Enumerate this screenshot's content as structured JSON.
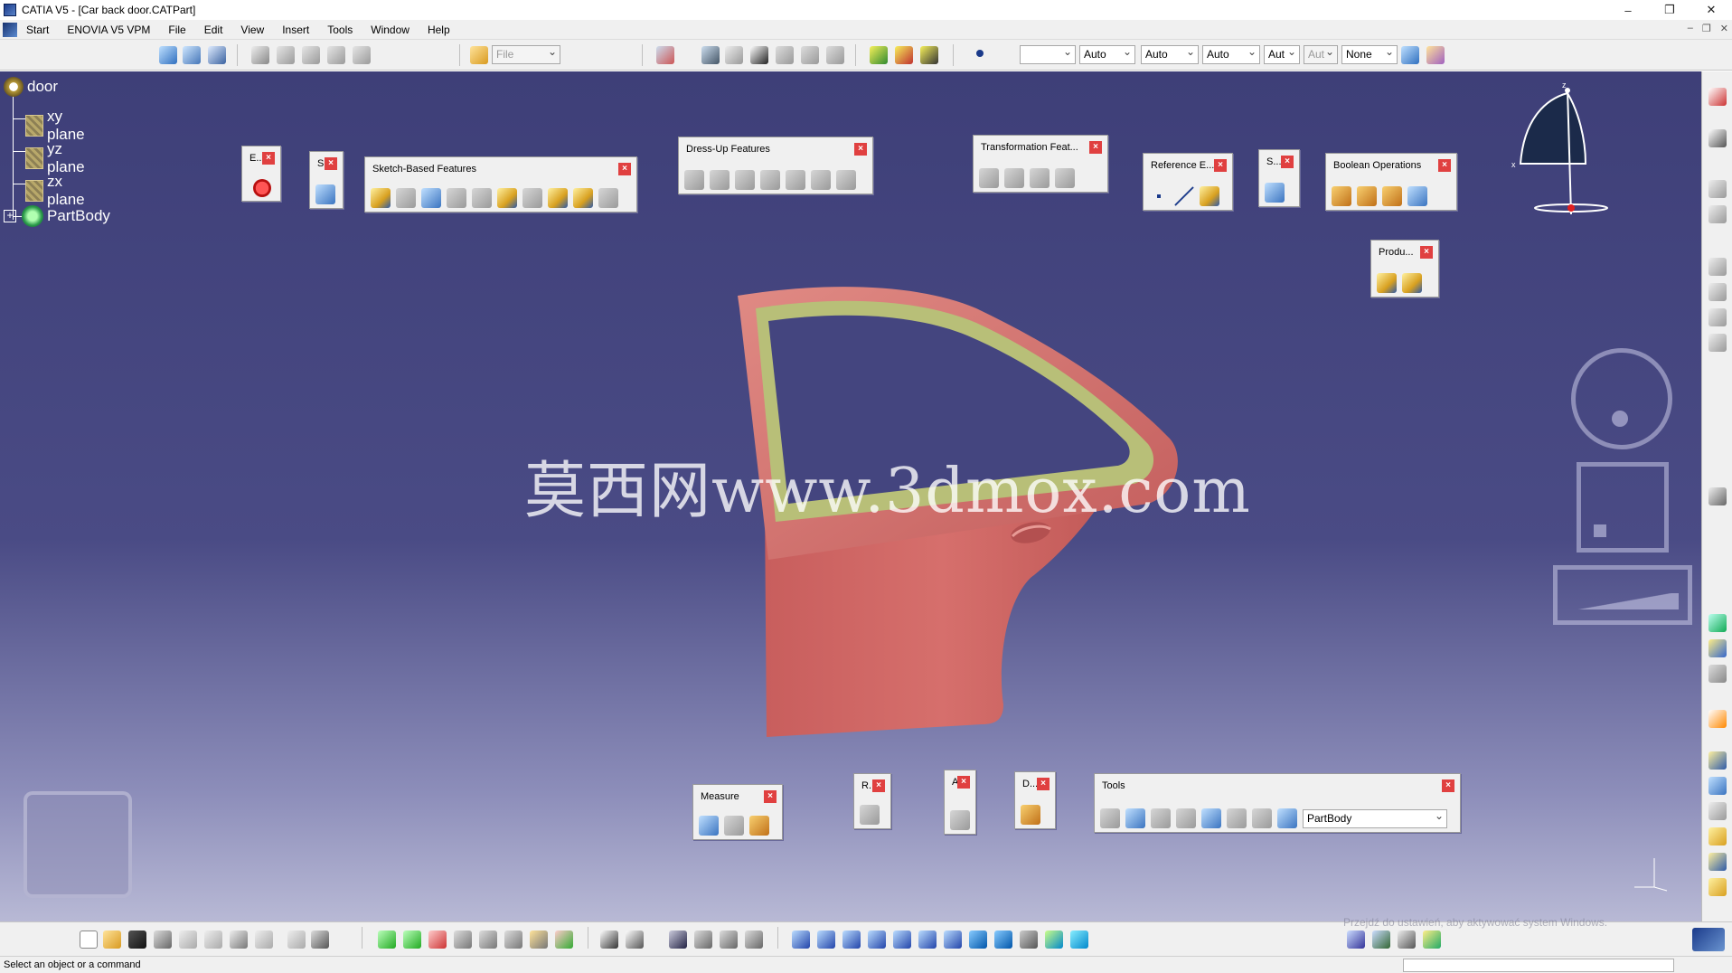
{
  "window": {
    "title": "CATIA V5 - [Car back door.CATPart]",
    "controls": [
      "–",
      "❐",
      "✕"
    ]
  },
  "menu": {
    "items": [
      "Start",
      "ENOVIA V5 VPM",
      "File",
      "Edit",
      "View",
      "Insert",
      "Tools",
      "Window",
      "Help"
    ],
    "mdi": [
      "–",
      "❐",
      "✕"
    ]
  },
  "toolbar": {
    "file_combo": "File",
    "combos": [
      "",
      "Auto",
      "Auto",
      "Auto",
      "Aut",
      "Aut",
      "None"
    ]
  },
  "tree": {
    "root": "door",
    "items": [
      "xy plane",
      "yz plane",
      "zx plane",
      "PartBody"
    ]
  },
  "floating_toolbars": {
    "exit": "E...",
    "sketcher": "S",
    "sketch_based": "Sketch-Based Features",
    "dress_up": "Dress-Up Features",
    "transformation": "Transformation Feat...",
    "reference": "Reference E...",
    "surface": "S...",
    "boolean": "Boolean Operations",
    "product": "Produ...",
    "measure": "Measure",
    "render": "R...",
    "analysis": "A",
    "drafting": "D...",
    "tools": "Tools",
    "tools_combo": "PartBody",
    "close": "×"
  },
  "watermark": "莫西网www.3dmox.com",
  "compass": {
    "z": "z",
    "x": "x"
  },
  "windows_activation": "Przejdź do ustawień, aby aktywować system Windows.",
  "status": {
    "message": "Select an object or a command"
  },
  "colors": {
    "viewport_top": "#3e3f78",
    "door_body": "#d26a68",
    "door_seal": "#b8bf78",
    "toolbar_bg": "#f0f0f0",
    "close_red": "#e04040"
  }
}
